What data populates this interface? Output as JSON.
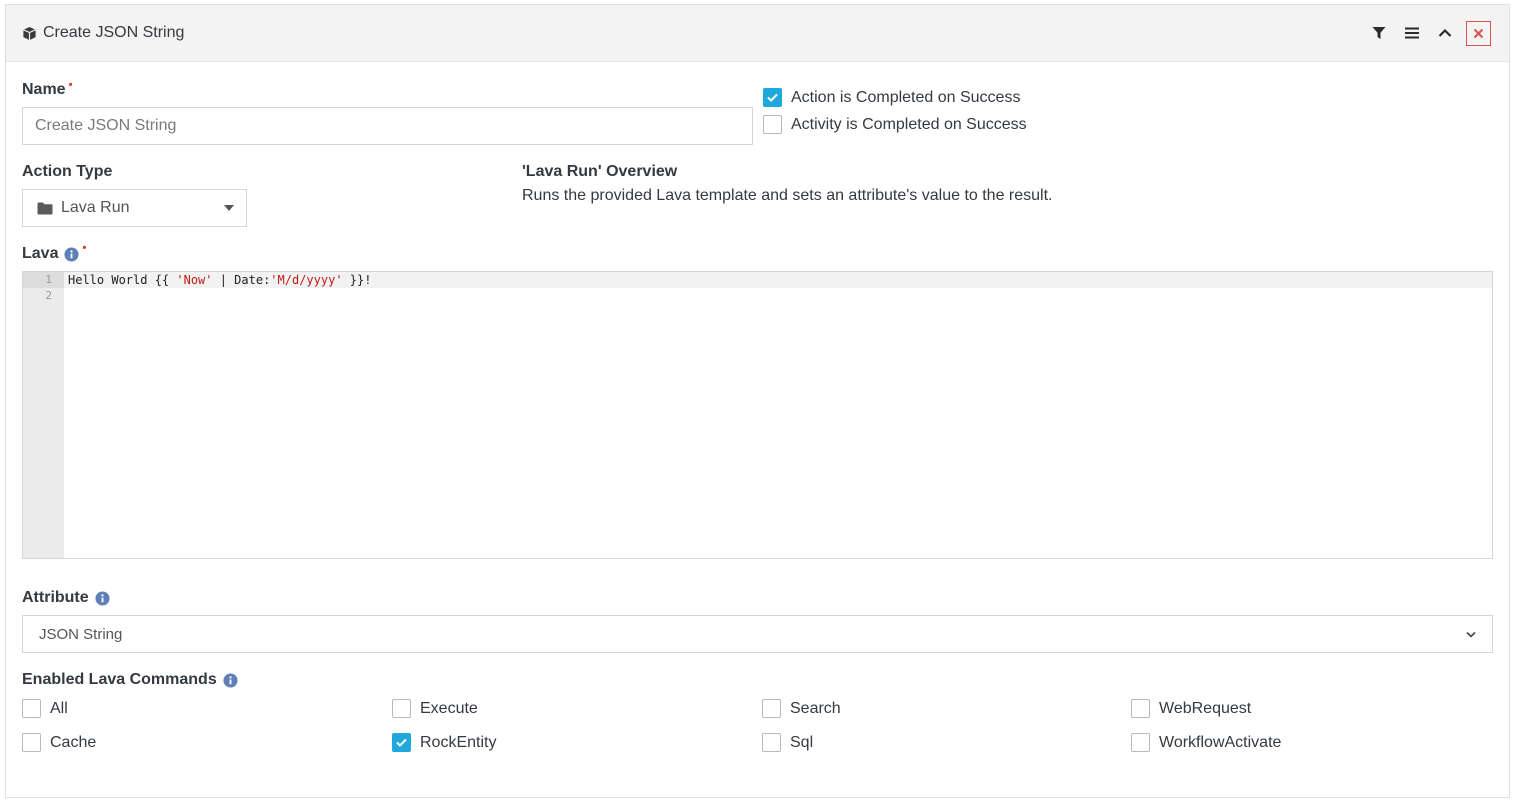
{
  "panel": {
    "title": "Create JSON String",
    "title_icon": "cube-icon",
    "actions": [
      "filter-icon",
      "bars-icon",
      "chevron-up-icon",
      "close-icon"
    ]
  },
  "name_field": {
    "label": "Name",
    "required_mark": "•",
    "placeholder": "Create JSON String"
  },
  "completion": {
    "action_completed": {
      "label": "Action is Completed on Success",
      "checked": true
    },
    "activity_completed": {
      "label": "Activity is Completed on Success",
      "checked": false
    }
  },
  "action_type": {
    "label": "Action Type",
    "selected": "Lava Run",
    "icon": "folder-icon"
  },
  "overview": {
    "title": "'Lava Run' Overview",
    "text": "Runs the provided Lava template and sets an attribute's value to the result."
  },
  "lava": {
    "label": "Lava",
    "required_mark": "•",
    "line_numbers": [
      "1",
      "2"
    ],
    "code_parts": {
      "p1": "Hello World {{ ",
      "s1": "'Now'",
      "p2": " | Date:",
      "s2": "'M/d/yyyy'",
      "p3": " }}!"
    }
  },
  "attribute": {
    "label": "Attribute",
    "selected": "JSON String"
  },
  "lava_commands": {
    "label": "Enabled Lava Commands",
    "items": [
      {
        "label": "All",
        "checked": false
      },
      {
        "label": "Execute",
        "checked": false
      },
      {
        "label": "Search",
        "checked": false
      },
      {
        "label": "WebRequest",
        "checked": false
      },
      {
        "label": "Cache",
        "checked": false
      },
      {
        "label": "RockEntity",
        "checked": true
      },
      {
        "label": "Sql",
        "checked": false
      },
      {
        "label": "WorkflowActivate",
        "checked": false
      }
    ]
  },
  "colors": {
    "accent": "#1fa8dc",
    "required": "#d9342b",
    "info": "#5f7fb8",
    "close": "#d9534f"
  }
}
